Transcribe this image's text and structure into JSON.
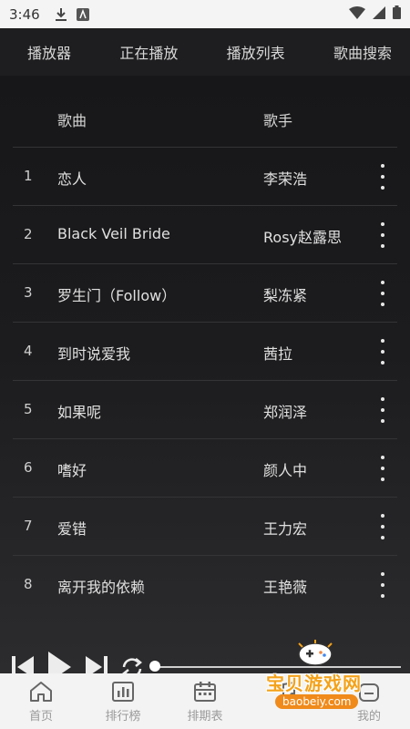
{
  "status_bar": {
    "time": "3:46"
  },
  "tabs": [
    {
      "label": "播放器"
    },
    {
      "label": "正在播放"
    },
    {
      "label": "播放列表"
    },
    {
      "label": "歌曲搜索"
    }
  ],
  "table": {
    "headers": {
      "song": "歌曲",
      "artist": "歌手"
    },
    "rows": [
      {
        "num": "1",
        "title": "恋人",
        "artist": "李荣浩"
      },
      {
        "num": "2",
        "title": "Black Veil Bride",
        "artist": "Rosy赵露思"
      },
      {
        "num": "3",
        "title": "罗生门（Follow）",
        "artist": "梨冻紧"
      },
      {
        "num": "4",
        "title": "到时说爱我",
        "artist": "茜拉"
      },
      {
        "num": "5",
        "title": "如果呢",
        "artist": "郑润泽"
      },
      {
        "num": "6",
        "title": "嗜好",
        "artist": "颜人中"
      },
      {
        "num": "7",
        "title": "爱错",
        "artist": "王力宏"
      },
      {
        "num": "8",
        "title": "离开我的依赖",
        "artist": "王艳薇"
      }
    ]
  },
  "player": {
    "progress_fraction": 0.0
  },
  "bottom_nav": [
    {
      "label": "首页",
      "icon": "home-icon"
    },
    {
      "label": "排行榜",
      "icon": "chart-icon"
    },
    {
      "label": "排期表",
      "icon": "calendar-icon"
    },
    {
      "label": "",
      "icon": "note-icon"
    },
    {
      "label": "我的",
      "icon": "profile-icon"
    }
  ],
  "watermark": {
    "text": "宝贝游戏网",
    "url": "baobeiy.com"
  },
  "colors": {
    "background": "#1b1b1d",
    "nav_background": "#f3f3f3",
    "watermark_orange": "#f4a21a"
  }
}
